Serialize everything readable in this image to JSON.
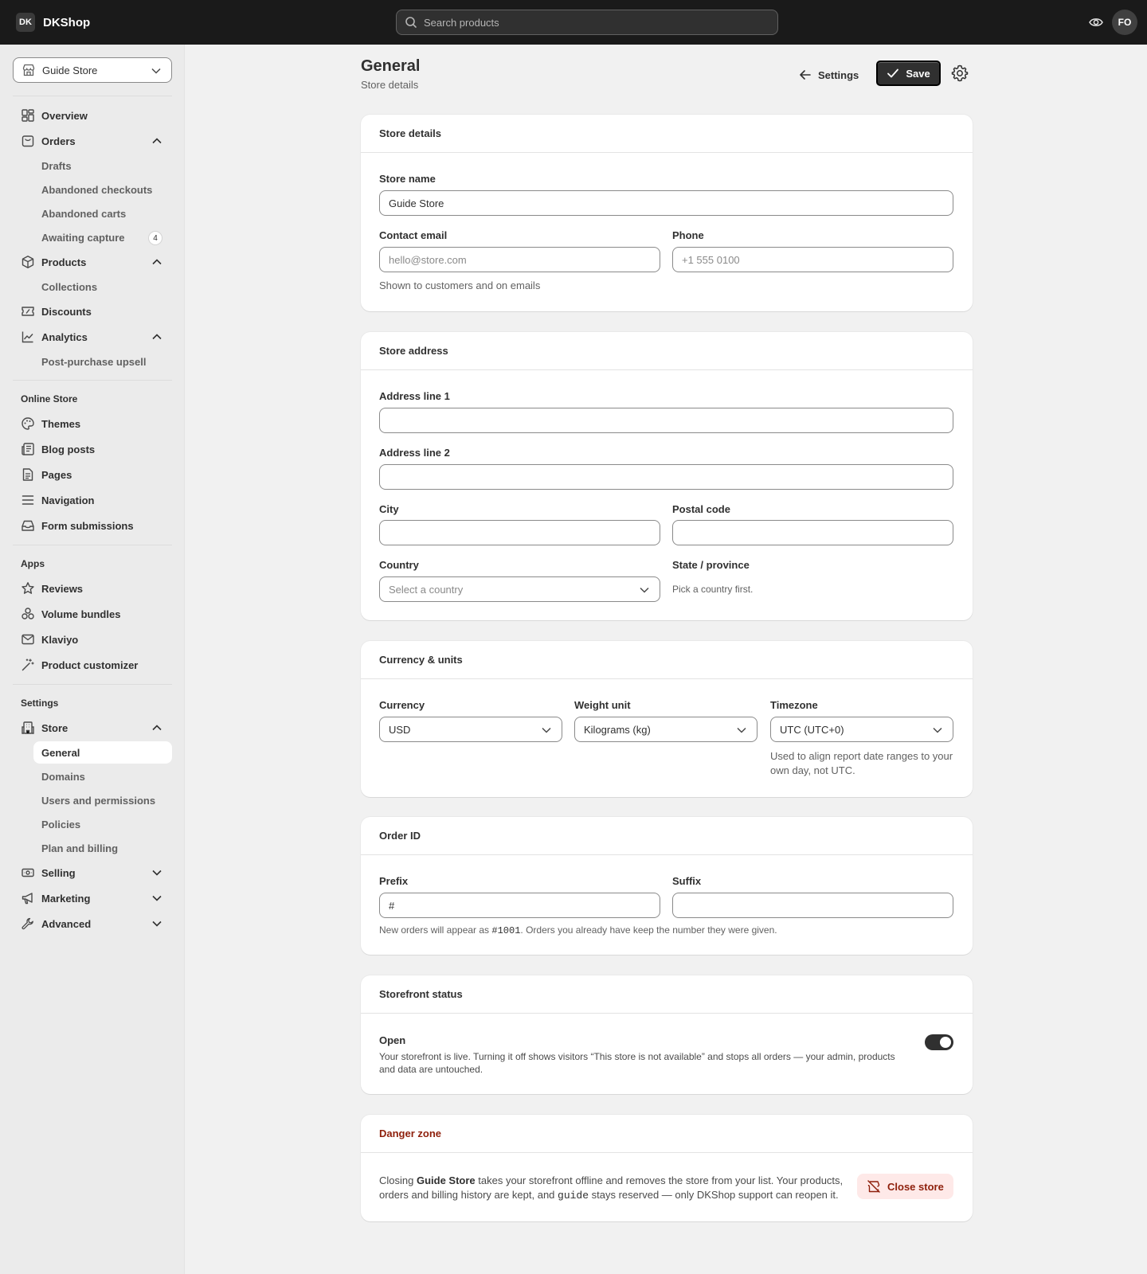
{
  "topbar": {
    "brand_badge": "DK",
    "brand_name": "DKShop",
    "search_placeholder": "Search products",
    "avatar_initials": "FO"
  },
  "sidebar": {
    "store_selector": "Guide Store",
    "items": {
      "overview": "Overview",
      "orders": "Orders",
      "drafts": "Drafts",
      "abandoned_checkouts": "Abandoned checkouts",
      "abandoned_carts": "Abandoned carts",
      "awaiting_capture": "Awaiting capture",
      "awaiting_capture_count": "4",
      "products": "Products",
      "collections": "Collections",
      "discounts": "Discounts",
      "analytics": "Analytics",
      "post_purchase_upsell": "Post-purchase upsell"
    },
    "online_store": {
      "heading": "Online Store",
      "themes": "Themes",
      "blog_posts": "Blog posts",
      "pages": "Pages",
      "navigation": "Navigation",
      "form_submissions": "Form submissions"
    },
    "apps": {
      "heading": "Apps",
      "reviews": "Reviews",
      "volume_bundles": "Volume bundles",
      "klaviyo": "Klaviyo",
      "product_customizer": "Product customizer"
    },
    "settings": {
      "heading": "Settings",
      "store": "Store",
      "general": "General",
      "domains": "Domains",
      "users": "Users and permissions",
      "policies": "Policies",
      "plan": "Plan and billing",
      "selling": "Selling",
      "marketing": "Marketing",
      "advanced": "Advanced"
    }
  },
  "header": {
    "title": "General",
    "subtitle": "Store details",
    "settings_label": "Settings",
    "save_label": "Save"
  },
  "store_details": {
    "title": "Store details",
    "store_name_label": "Store name",
    "store_name_value": "Guide Store",
    "contact_email_label": "Contact email",
    "contact_email_placeholder": "hello@store.com",
    "phone_label": "Phone",
    "phone_placeholder": "+1 555 0100",
    "help": "Shown to customers and on emails"
  },
  "store_address": {
    "title": "Store address",
    "address1_label": "Address line 1",
    "address2_label": "Address line 2",
    "city_label": "City",
    "postal_label": "Postal code",
    "country_label": "Country",
    "country_placeholder": "Select a country",
    "state_label": "State / province",
    "state_help": "Pick a country first."
  },
  "currency_units": {
    "title": "Currency & units",
    "currency_label": "Currency",
    "currency_value": "USD",
    "weight_label": "Weight unit",
    "weight_value": "Kilograms (kg)",
    "timezone_label": "Timezone",
    "timezone_value": "UTC (UTC+0)",
    "timezone_help": "Used to align report date ranges to your own day, not UTC."
  },
  "order_id": {
    "title": "Order ID",
    "prefix_label": "Prefix",
    "prefix_value": "#",
    "suffix_label": "Suffix",
    "help_pre": "New orders will appear as ",
    "help_code": "#1001",
    "help_post": ". Orders you already have keep the number they were given."
  },
  "storefront_status": {
    "title": "Storefront status",
    "label": "Open",
    "description": "Your storefront is live. Turning it off shows visitors “This store is not available” and stops all orders — your admin, products and data are untouched.",
    "toggle_on": true
  },
  "danger_zone": {
    "title": "Danger zone",
    "text_pre": "Closing ",
    "text_store": "Guide Store",
    "text_mid": " takes your storefront offline and removes the store from your list. Your products, orders and billing history are kept, and ",
    "text_handle": "guide",
    "text_post": " stays reserved — only DKShop support can reopen it.",
    "close_label": "Close store"
  },
  "colors": {
    "topbar": "#1a1a1a",
    "sidebar": "#ebebeb",
    "page_bg": "#f1f1f1",
    "primary_button": "#303030",
    "danger_text": "#8e1f0b",
    "danger_bg": "#fee9e8"
  },
  "icons": [
    "store-icon",
    "search-icon",
    "eye-icon",
    "home-grid-icon",
    "orders-bag-icon",
    "box-icon",
    "discount-icon",
    "analytics-icon",
    "palette-icon",
    "blog-icon",
    "page-icon",
    "menu-icon",
    "inbox-icon",
    "star-icon",
    "bundle-icon",
    "mail-icon",
    "magic-wand-icon",
    "building-icon",
    "cash-icon",
    "megaphone-icon",
    "wrench-icon",
    "arrow-left-icon",
    "check-icon",
    "gear-icon",
    "chevron-down-icon",
    "chevron-up-icon",
    "store-off-icon"
  ]
}
